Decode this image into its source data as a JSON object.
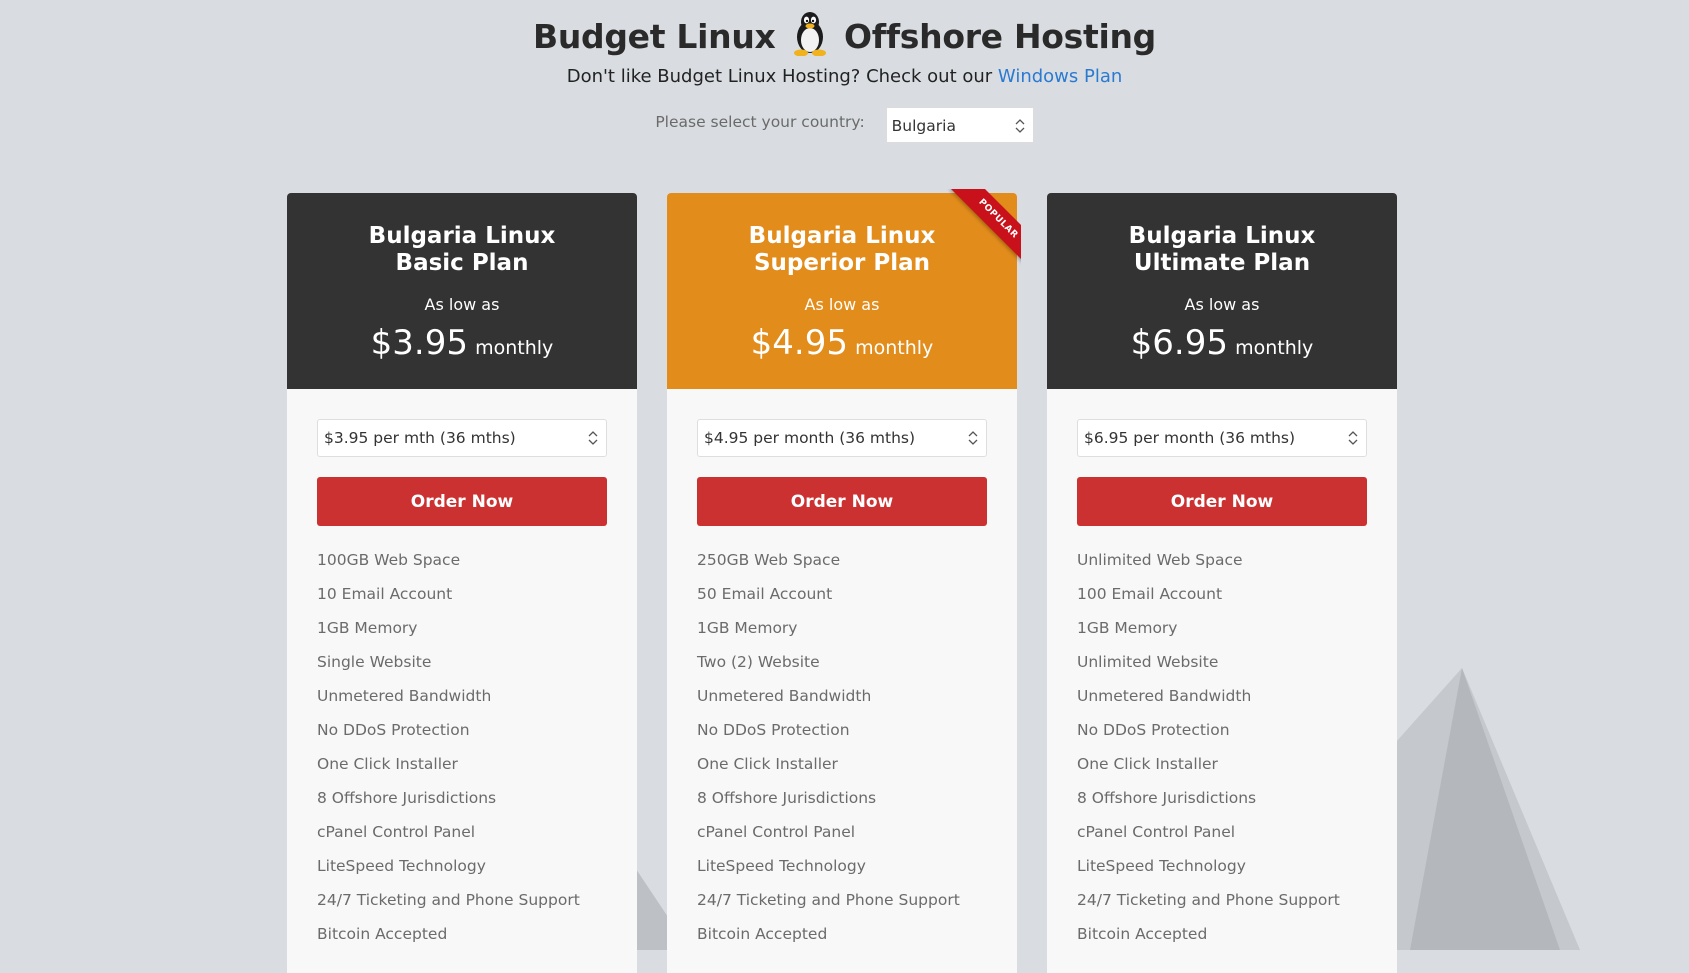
{
  "header": {
    "title_left": "Budget Linux",
    "title_right": "Offshore Hosting",
    "subtitle_text": "Don't like Budget Linux Hosting? Check out our",
    "subtitle_link": "Windows Plan",
    "country_label": "Please select your country:",
    "country_value": "Bulgaria"
  },
  "plans": [
    {
      "name_line1": "Bulgaria Linux",
      "name_line2": "Basic Plan",
      "as_low": "As low as",
      "price": "$3.95",
      "per": "monthly",
      "term": "$3.95 per mth (36 mths)",
      "order_label": "Order Now",
      "features": [
        "100GB Web Space",
        "10 Email Account",
        "1GB Memory",
        "Single Website",
        "Unmetered Bandwidth",
        "No DDoS Protection",
        "One Click Installer",
        "8 Offshore Jurisdictions",
        "cPanel Control Panel",
        "LiteSpeed Technology",
        "24/7 Ticketing and Phone Support",
        "Bitcoin Accepted"
      ]
    },
    {
      "name_line1": "Bulgaria Linux",
      "name_line2": "Superior Plan",
      "as_low": "As low as",
      "price": "$4.95",
      "per": "monthly",
      "term": "$4.95 per month (36 mths)",
      "order_label": "Order Now",
      "badge": "POPULAR",
      "features": [
        "250GB Web Space",
        "50 Email Account",
        "1GB Memory",
        "Two (2) Website",
        "Unmetered Bandwidth",
        "No DDoS Protection",
        "One Click Installer",
        "8 Offshore Jurisdictions",
        "cPanel Control Panel",
        "LiteSpeed Technology",
        "24/7 Ticketing and Phone Support",
        "Bitcoin Accepted"
      ]
    },
    {
      "name_line1": "Bulgaria Linux",
      "name_line2": "Ultimate Plan",
      "as_low": "As low as",
      "price": "$6.95",
      "per": "monthly",
      "term": "$6.95 per month (36 mths)",
      "order_label": "Order Now",
      "features": [
        "Unlimited Web Space",
        "100 Email Account",
        "1GB Memory",
        "Unlimited Website",
        "Unmetered Bandwidth",
        "No DDoS Protection",
        "One Click Installer",
        "8 Offshore Jurisdictions",
        "cPanel Control Panel",
        "LiteSpeed Technology",
        "24/7 Ticketing and Phone Support",
        "Bitcoin Accepted"
      ]
    }
  ],
  "colors": {
    "background": "#d9dde2",
    "dark_header": "#333333",
    "popular_header": "#e28c1b",
    "order_button": "#cc3131",
    "link": "#2a7ad1",
    "ribbon": "#c8111b"
  }
}
